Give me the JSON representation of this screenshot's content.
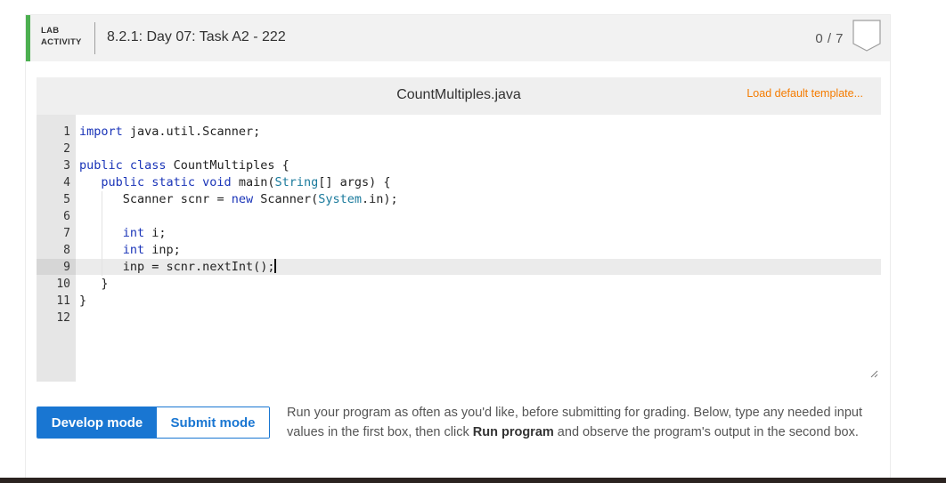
{
  "header": {
    "lab_label_line1": "LAB",
    "lab_label_line2": "ACTIVITY",
    "title": "8.2.1: Day 07: Task A2 - 222",
    "score": "0 / 7",
    "accent_color": "#4caf50"
  },
  "editor": {
    "filename": "CountMultiples.java",
    "load_template": "Load default template...",
    "line_numbers": [
      "1",
      "2",
      "3",
      "4",
      "5",
      "6",
      "7",
      "8",
      "9",
      "10",
      "11",
      "12"
    ],
    "lines": [
      {
        "indent": "",
        "tokens": [
          {
            "k": "kw",
            "t": "import"
          },
          {
            "k": "",
            "t": " java.util.Scanner;"
          }
        ]
      },
      {
        "indent": "",
        "tokens": []
      },
      {
        "indent": "",
        "tokens": [
          {
            "k": "kw",
            "t": "public class"
          },
          {
            "k": "",
            "t": " CountMultiples {"
          }
        ]
      },
      {
        "indent": "   ",
        "tokens": [
          {
            "k": "kw",
            "t": "public static void"
          },
          {
            "k": "",
            "t": " main("
          },
          {
            "k": "ty",
            "t": "String"
          },
          {
            "k": "",
            "t": "[] args) {"
          }
        ]
      },
      {
        "indent": "      ",
        "tokens": [
          {
            "k": "",
            "t": "Scanner scnr = "
          },
          {
            "k": "kw",
            "t": "new"
          },
          {
            "k": "",
            "t": " Scanner("
          },
          {
            "k": "ty",
            "t": "System"
          },
          {
            "k": "",
            "t": ".in);"
          }
        ]
      },
      {
        "indent": "",
        "tokens": []
      },
      {
        "indent": "      ",
        "tokens": [
          {
            "k": "kw",
            "t": "int"
          },
          {
            "k": "",
            "t": " i;"
          }
        ]
      },
      {
        "indent": "      ",
        "tokens": [
          {
            "k": "kw",
            "t": "int"
          },
          {
            "k": "",
            "t": " inp;"
          }
        ]
      },
      {
        "indent": "      ",
        "tokens": [
          {
            "k": "",
            "t": "inp = scnr.nextInt();"
          }
        ]
      },
      {
        "indent": "   ",
        "tokens": [
          {
            "k": "",
            "t": "}"
          }
        ]
      },
      {
        "indent": "",
        "tokens": [
          {
            "k": "",
            "t": "}"
          }
        ]
      },
      {
        "indent": "",
        "tokens": []
      }
    ],
    "active_line": 9,
    "keyword_color": "#1a34b8",
    "type_color": "#1a7a9c"
  },
  "modes": {
    "develop_label": "Develop mode",
    "submit_label": "Submit mode",
    "active": "develop"
  },
  "instructions": {
    "part1": "Run your program as often as you'd like, before submitting for grading. Below, type any needed input values in the first box, then click ",
    "bold": "Run program",
    "part2": " and observe the program's output in the second box."
  }
}
